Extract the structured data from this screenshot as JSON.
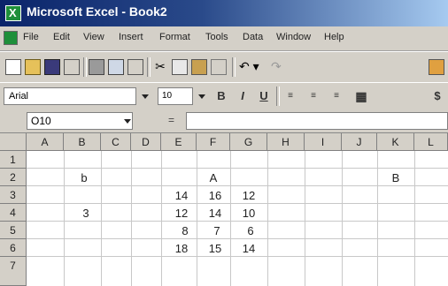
{
  "window": {
    "title": "Microsoft Excel - Book2"
  },
  "menu": {
    "items": [
      "File",
      "Edit",
      "View",
      "Insert",
      "Format",
      "Tools",
      "Data",
      "Window",
      "Help"
    ]
  },
  "format_toolbar": {
    "font": "Arial",
    "size": "10",
    "bold": "B",
    "italic": "I",
    "underline": "U"
  },
  "formula_bar": {
    "cell_ref": "O10",
    "fx": "="
  },
  "columns": [
    "A",
    "B",
    "C",
    "D",
    "E",
    "F",
    "G",
    "H",
    "I",
    "J",
    "K",
    "L"
  ],
  "rows": [
    "1",
    "2",
    "3",
    "4",
    "5",
    "6",
    "7"
  ],
  "cells": {
    "b2": "b",
    "f2": "A",
    "k2": "B",
    "e3": "14",
    "f3": "16",
    "g3": "12",
    "b4": "3",
    "e4": "12",
    "f4": "14",
    "g4": "10",
    "e5": "8",
    "f5": "7",
    "g5": "6",
    "e6": "18",
    "f6": "15",
    "g6": "14"
  }
}
